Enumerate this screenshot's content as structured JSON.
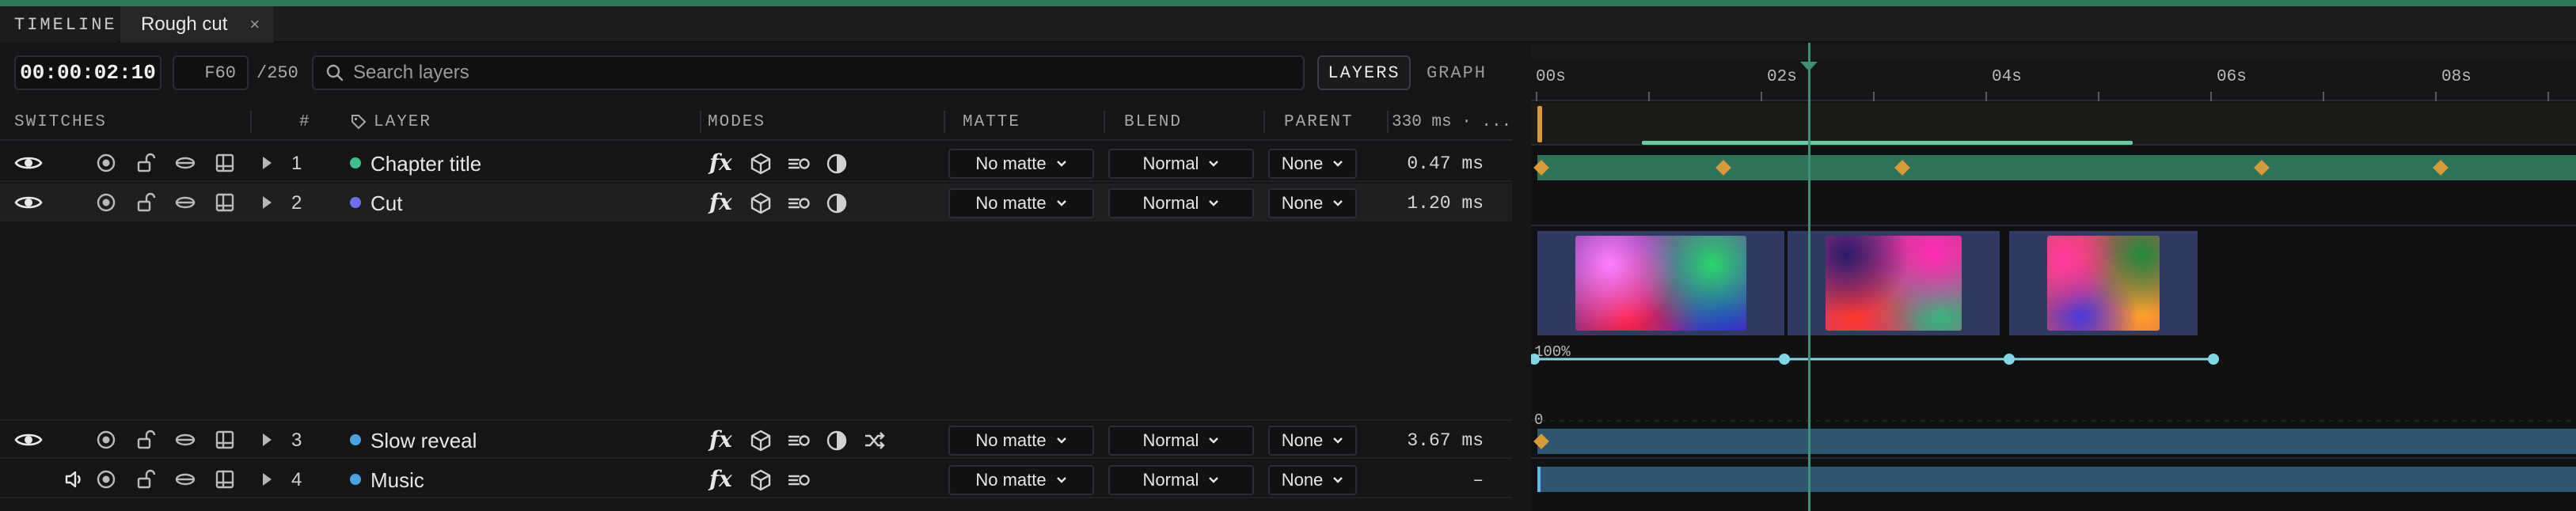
{
  "tabs": {
    "panel_label": "TIMELINE",
    "active_tab": "Rough cut",
    "close_glyph": "×"
  },
  "toolbar": {
    "timecode": "00:00:02:10",
    "frame_prefix": "F",
    "frame": "60",
    "frame_total": "/250",
    "search_placeholder": "Search layers",
    "layers_button": "LAYERS",
    "graph_button": "GRAPH"
  },
  "columns": {
    "switches": "SWITCHES",
    "number": "#",
    "layer": "LAYER",
    "modes": "MODES",
    "matte": "MATTE",
    "blend": "BLEND",
    "parent": "PARENT",
    "render": "330 ms · ..."
  },
  "layers": [
    {
      "num": "1",
      "name": "Chapter title",
      "dot": "#3fbf8a",
      "matte": "No matte",
      "blend": "Normal",
      "parent": "None",
      "time": "0.47 ms",
      "visibility": "eye-icon"
    },
    {
      "num": "2",
      "name": "Cut",
      "dot": "#6b6ff0",
      "matte": "No matte",
      "blend": "Normal",
      "parent": "None",
      "time": "1.20 ms",
      "visibility": "eye-icon"
    },
    {
      "num": "3",
      "name": "Slow reveal",
      "dot": "#4aa3e0",
      "matte": "No matte",
      "blend": "Normal",
      "parent": "None",
      "time": "3.67 ms",
      "visibility": "eye-icon"
    },
    {
      "num": "4",
      "name": "Music",
      "dot": "#4aa3e0",
      "matte": "No matte",
      "blend": "Normal",
      "parent": "None",
      "time": "–",
      "visibility": "speaker-icon"
    }
  ],
  "ruler": {
    "labels": [
      "00s",
      "02s",
      "04s",
      "06s",
      "08s"
    ]
  },
  "graph": {
    "top_label": "100%",
    "bottom_label": "0"
  },
  "colors": {
    "accent_green": "#3c8e74",
    "keyframe": "#d89a38",
    "track_green": "#2f7358",
    "track_blue": "#2e5670",
    "clip_bg": "#2e3a5f",
    "curve": "#7fd8e6"
  },
  "icons": {
    "switches": [
      "solo-icon",
      "lock-icon",
      "shy-icon",
      "collapse-icon"
    ],
    "modes": [
      "fx-icon",
      "3d-cube-icon",
      "motion-blur-icon",
      "adjustment-icon",
      "shuffle-icon"
    ],
    "tag": "tag-icon",
    "search": "search-icon"
  }
}
